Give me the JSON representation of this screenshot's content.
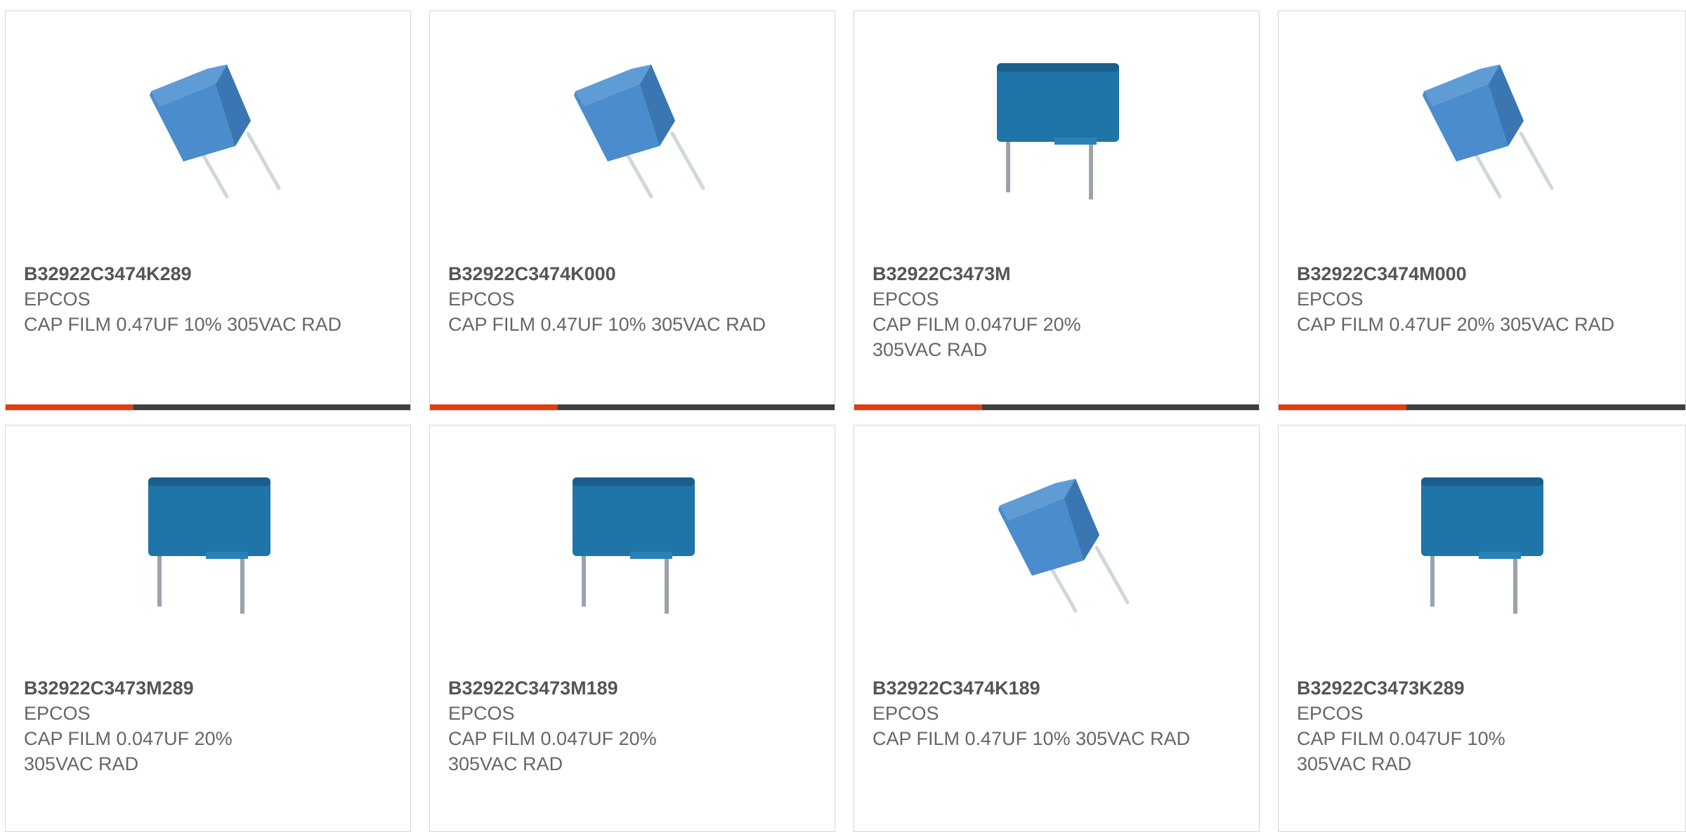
{
  "colors": {
    "accent": "#e33d0e",
    "bar": "#3f3f3f",
    "capacitor_tilted": "#4a8ccc",
    "capacitor_box": "#1f74a8",
    "text": "#666666"
  },
  "products": [
    {
      "part_number": "B32922C3474K289",
      "manufacturer": "EPCOS",
      "description": "CAP FILM 0.47UF 10% 305VAC RAD",
      "image_icon": "capacitor-tilted-icon"
    },
    {
      "part_number": "B32922C3474K000",
      "manufacturer": "EPCOS",
      "description": "CAP FILM 0.47UF 10% 305VAC RAD",
      "image_icon": "capacitor-tilted-icon"
    },
    {
      "part_number": "B32922C3473M",
      "manufacturer": "EPCOS",
      "description": "CAP FILM 0.047UF 20% 305VAC RAD",
      "image_icon": "capacitor-box-icon"
    },
    {
      "part_number": "B32922C3474M000",
      "manufacturer": "EPCOS",
      "description": "CAP FILM 0.47UF 20% 305VAC RAD",
      "image_icon": "capacitor-tilted-icon"
    },
    {
      "part_number": "B32922C3473M289",
      "manufacturer": "EPCOS",
      "description": "CAP FILM 0.047UF 20% 305VAC RAD",
      "image_icon": "capacitor-box-icon"
    },
    {
      "part_number": "B32922C3473M189",
      "manufacturer": "EPCOS",
      "description": "CAP FILM 0.047UF 20% 305VAC RAD",
      "image_icon": "capacitor-box-icon"
    },
    {
      "part_number": "B32922C3474K189",
      "manufacturer": "EPCOS",
      "description": "CAP FILM 0.47UF 10% 305VAC RAD",
      "image_icon": "capacitor-tilted-icon"
    },
    {
      "part_number": "B32922C3473K289",
      "manufacturer": "EPCOS",
      "description": "CAP FILM 0.047UF 10% 305VAC RAD",
      "image_icon": "capacitor-box-icon"
    }
  ]
}
